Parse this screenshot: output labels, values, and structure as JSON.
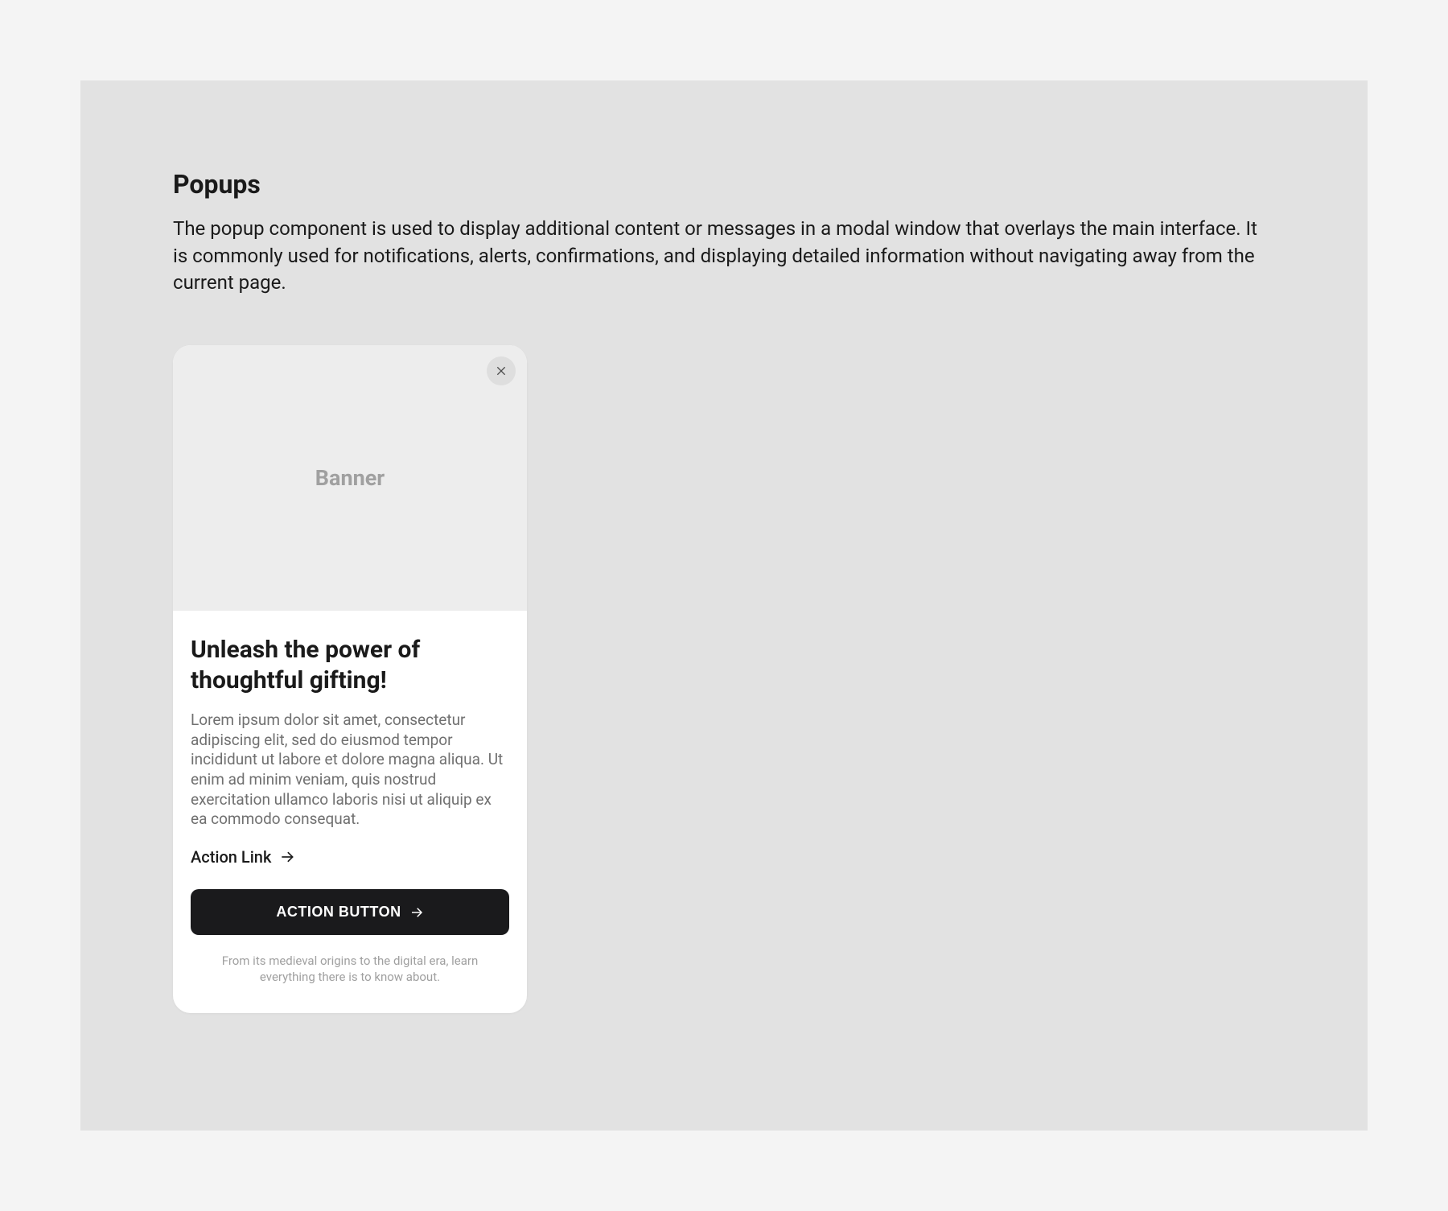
{
  "section": {
    "title": "Popups",
    "description": "The popup component is used to display additional content or messages in a modal window that overlays the main interface. It is commonly used for notifications, alerts, confirmations, and displaying detailed information without navigating away from the current page."
  },
  "popup": {
    "banner_label": "Banner",
    "title": "Unleash the power of thoughtful gifting!",
    "body": "Lorem ipsum dolor sit amet, consectetur adipiscing elit, sed do eiusmod tempor incididunt ut labore et dolore magna aliqua. Ut enim ad minim veniam, quis nostrud exercitation ullamco laboris nisi ut aliquip ex ea commodo consequat.",
    "link_label": "Action Link",
    "button_label": "ACTION BUTTON",
    "footnote": "From its medieval origins to the digital era, learn everything there is to know about."
  }
}
